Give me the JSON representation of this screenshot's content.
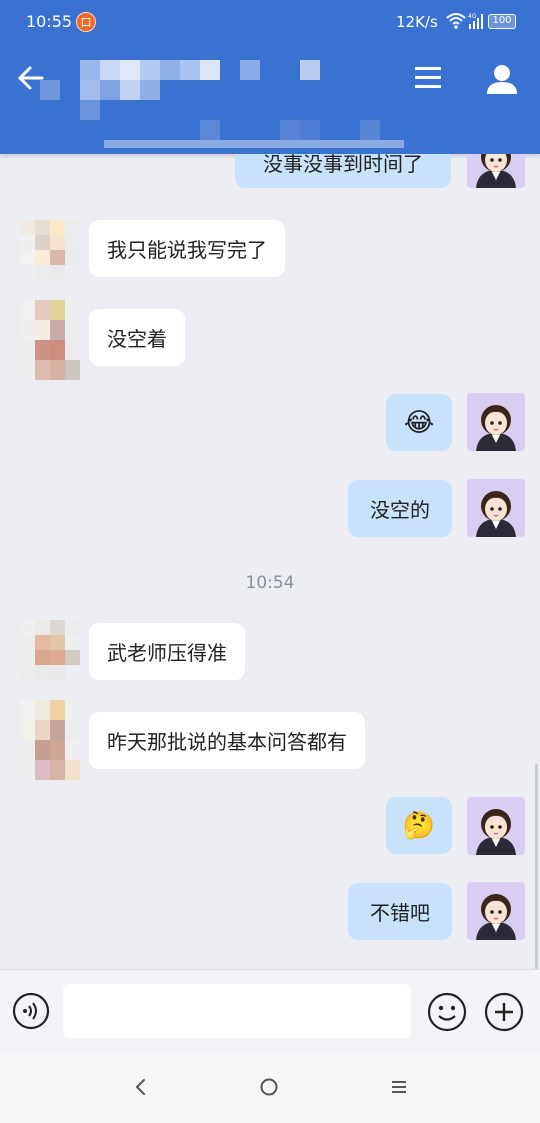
{
  "status_bar": {
    "time": "10:55",
    "notification_badge": "口",
    "network_speed": "12K/s",
    "signal_label": "4G",
    "battery": "100"
  },
  "header": {
    "back_icon": "back-arrow-icon",
    "menu_icon": "hamburger-menu-icon",
    "profile_icon": "person-icon",
    "title_blurred": true
  },
  "messages": [
    {
      "side": "right",
      "type": "text",
      "text": "没事没事到时间了"
    },
    {
      "side": "left",
      "type": "text",
      "text": "我只能说我写完了"
    },
    {
      "side": "left",
      "type": "text",
      "text": "没空着"
    },
    {
      "side": "right",
      "type": "emoji",
      "text": "😂"
    },
    {
      "side": "right",
      "type": "text",
      "text": "没空的"
    },
    {
      "side": "left",
      "type": "text",
      "text": "武老师压得准"
    },
    {
      "side": "left",
      "type": "text",
      "text": "昨天那批说的基本问答都有"
    },
    {
      "side": "right",
      "type": "emoji",
      "text": "🤔"
    },
    {
      "side": "right",
      "type": "text",
      "text": "不错吧"
    }
  ],
  "timestamp": "10:54",
  "input_bar": {
    "voice_icon": "voice-icon",
    "input_value": "",
    "emoji_icon": "smiley-icon",
    "plus_icon": "plus-circle-icon"
  },
  "nav_bar": {
    "back_icon": "nav-back-icon",
    "home_icon": "nav-home-icon",
    "menu_icon": "nav-menu-icon"
  },
  "colors": {
    "header": "#3a72d2",
    "chat_background": "#ebedf2",
    "my_bubble": "#c8e2fb",
    "their_bubble": "#ffffff"
  }
}
